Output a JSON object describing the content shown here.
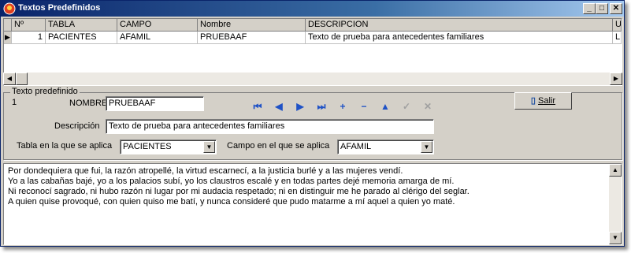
{
  "window": {
    "title": "Textos Predefinidos",
    "min": "_",
    "max": "□",
    "close": "✕"
  },
  "grid": {
    "columns": [
      "Nº",
      "TABLA",
      "CAMPO",
      "Nombre",
      "DESCRIPCION",
      "U"
    ],
    "rows": [
      {
        "n": "1",
        "tabla": "PACIENTES",
        "campo": "AFAMIL",
        "nombre": "PRUEBAAF",
        "descripcion": "Texto de prueba para antecedentes familiares",
        "u": "L"
      }
    ]
  },
  "form": {
    "legend": "Texto  predefinido",
    "record_no": "1",
    "nombre_label": "NOMBRE",
    "nombre_value": "PRUEBAAF",
    "descripcion_label": "Descripción",
    "descripcion_value": "Texto de prueba para antecedentes familiares",
    "tabla_label": "Tabla en la que se aplica",
    "tabla_value": "PACIENTES",
    "campo_label": "Campo en el que se aplica",
    "campo_value": "AFAMIL",
    "salir_label": "Salir"
  },
  "nav_icons": [
    "first-icon",
    "prior-icon",
    "next-icon",
    "last-icon",
    "insert-icon",
    "delete-icon",
    "edit-icon",
    "post-icon",
    "cancel-icon"
  ],
  "memo": {
    "lines": [
      "Por dondequiera que fui, la razón atropellé, la virtud escarnecí, a la justicia burlé y a las mujeres vendí.",
      "Yo a las cabañas bajé, yo a los palacios subí, yo los claustros escalé y en todas partes dejé memoria amarga de mí.",
      "Ni reconocí sagrado, ni hubo razón ni lugar por mi audacia respetado; ni en distinguir me he parado al clérigo del seglar.",
      "A quien quise provoqué, con quien quiso me batí, y nunca consideré que pudo matarme a mí aquel a quien yo maté."
    ]
  },
  "colors": {
    "titlebar": "#0a246a",
    "nav_icon": "#1f52c6",
    "face": "#d4d0c8"
  }
}
